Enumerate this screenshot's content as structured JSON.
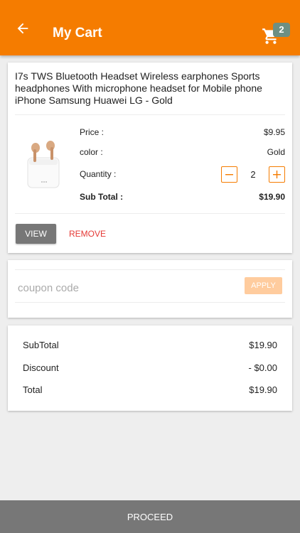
{
  "appbar": {
    "title": "My Cart",
    "back_icon": "arrow-left-icon",
    "cart_icon": "shopping-cart-icon",
    "cart_count": "2",
    "color": "#f57c00"
  },
  "product": {
    "name": "I7s TWS Bluetooth Headset Wireless earphones Sports headphones With microphone headset for Mobile phone iPhone Samsung Huawei LG - Gold",
    "image_icon": "earbuds-product-image",
    "price_label": "Price :",
    "price_value": "$9.95",
    "color_label": "color :",
    "color_value": "Gold",
    "quantity_label": "Quantity :",
    "quantity_value": "2",
    "subtotal_label": "Sub Total :",
    "subtotal_value": "$19.90",
    "view_label": "VIEW",
    "remove_label": "REMOVE"
  },
  "coupon": {
    "placeholder": "coupon code",
    "apply_label": "APPLY"
  },
  "summary": {
    "subtotal_label": "SubTotal",
    "subtotal_value": "$19.90",
    "discount_label": "Discount",
    "discount_value": "- $0.00",
    "total_label": "Total",
    "total_value": "$19.90"
  },
  "footer": {
    "proceed_label": "PROCEED"
  }
}
